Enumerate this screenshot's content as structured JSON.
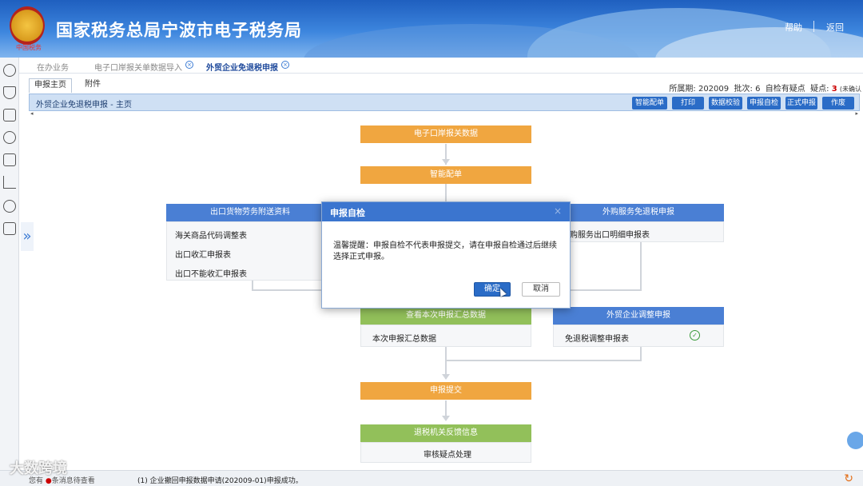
{
  "header": {
    "title": "国家税务总局宁波市电子税务局",
    "emblem_text": "中国税务",
    "help": "帮助",
    "back": "返回"
  },
  "toptabs": [
    {
      "label": "在办业务"
    },
    {
      "label": "电子口岸报关单数据导入"
    },
    {
      "label": "外贸企业免退税申报"
    }
  ],
  "subtabs": {
    "main": "申报主页",
    "attachment": "附件"
  },
  "info": {
    "period_label": "所属期:",
    "period": "202009",
    "batch_label": "批次:",
    "batch": "6",
    "doubt_label": "自检有疑点",
    "doubt_count_label": "疑点:",
    "doubt_count": "3",
    "unconfirmed": "(未确认"
  },
  "toolbar": {
    "title": "外贸企业免退税申报 - 主页",
    "buttons": [
      "智能配单",
      "打印",
      "数据校验",
      "申报自检",
      "正式申报",
      "作废"
    ]
  },
  "flow": {
    "step1": "电子口岸报关数据",
    "step2": "智能配单",
    "left_header": "出口货物劳务附送资料",
    "left_items": [
      "海关商品代码调整表",
      "出口收汇申报表",
      "出口不能收汇申报表"
    ],
    "right_header": "外购服务免退税申报",
    "right_items": [
      "外购服务出口明细申报表"
    ],
    "summary_header": "查看本次申报汇总数据",
    "summary_item": "本次申报汇总数据",
    "adjust_header": "外贸企业调整申报",
    "adjust_item": "免退税调整申报表",
    "submit": "申报提交",
    "feedback_header": "退税机关反馈信息",
    "feedback_item": "审核疑点处理"
  },
  "modal": {
    "title": "申报自检",
    "close": "×",
    "message": "温馨提醒：申报自检不代表申报提交，请在申报自检通过后继续选择正式申报。",
    "ok": "确定",
    "cancel": "取消"
  },
  "status": {
    "left": "您有",
    "left2": "条消息待查看",
    "message": "(1)  企业撤回申报数据申请(202009-01)申报成功。"
  },
  "watermark": "大数跨境"
}
